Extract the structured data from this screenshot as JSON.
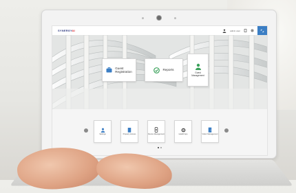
{
  "app": {
    "logo_text": "SYNERGY",
    "logo_accent": "AI",
    "user_label": "admin user"
  },
  "hero_tiles": [
    {
      "label_line1": "Guest",
      "label_line2": "Registration",
      "icon": "briefcase-icon"
    },
    {
      "label_line1": "Reports",
      "label_line2": "",
      "icon": "check-circle-icon"
    },
    {
      "label_line1": "Guest",
      "label_line2": "Management",
      "icon": "person-icon"
    }
  ],
  "bottom_tiles": [
    {
      "label": "Settings",
      "icon": "person-icon"
    },
    {
      "label": "Property Access",
      "icon": "building-icon"
    },
    {
      "label": "Device Management",
      "icon": "device-icon"
    },
    {
      "label": "Health App",
      "icon": "gear-icon"
    },
    {
      "label": "Visitor Management",
      "icon": "door-icon"
    }
  ],
  "carousel": {
    "pages": 2,
    "active": 0
  },
  "colors": {
    "accent_blue": "#3b7ec4",
    "icon_blue": "#3b7ec4",
    "icon_green": "#3aa15a",
    "logo_dark": "#2f3a80",
    "logo_red": "#d8232a"
  }
}
